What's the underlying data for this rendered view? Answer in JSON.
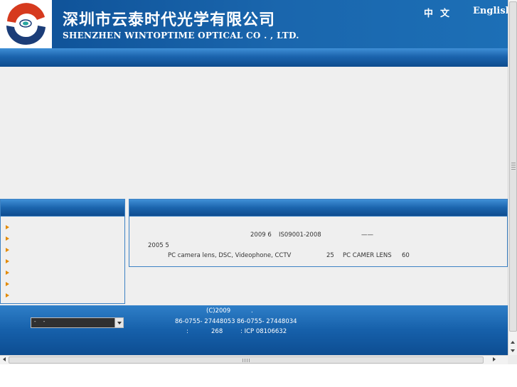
{
  "header": {
    "company_cn": "深圳市云泰时代光学有限公司",
    "company_en": "SHENZHEN WINTOPTIME OPTICAL CO . , LTD.",
    "lang_cn": "中文",
    "lang_en": "English"
  },
  "colors": {
    "brand_blue": "#1a66ad",
    "logo_red": "#d63a1e",
    "logo_navy": "#1b3d78",
    "menu_arrow": "#e38a00"
  },
  "about": {
    "line1_a": "2009 6",
    "line1_b": "IS09001-2008",
    "line1_c": "——",
    "line2": "2005 5",
    "line3_a": "PC camera lens, DSC, Videophone, CCTV",
    "line3_b": "25",
    "line3_c": "PC CAMER LENS",
    "line3_d": "60"
  },
  "footer": {
    "select_value": "- -",
    "copyright": "(C)2009",
    "copyright_dot": ".",
    "phone": "86-0755- 27448053",
    "fax": "86-0755- 27448034",
    "colon": ":",
    "address_no": "268",
    "icp": ": ICP 08106632"
  }
}
